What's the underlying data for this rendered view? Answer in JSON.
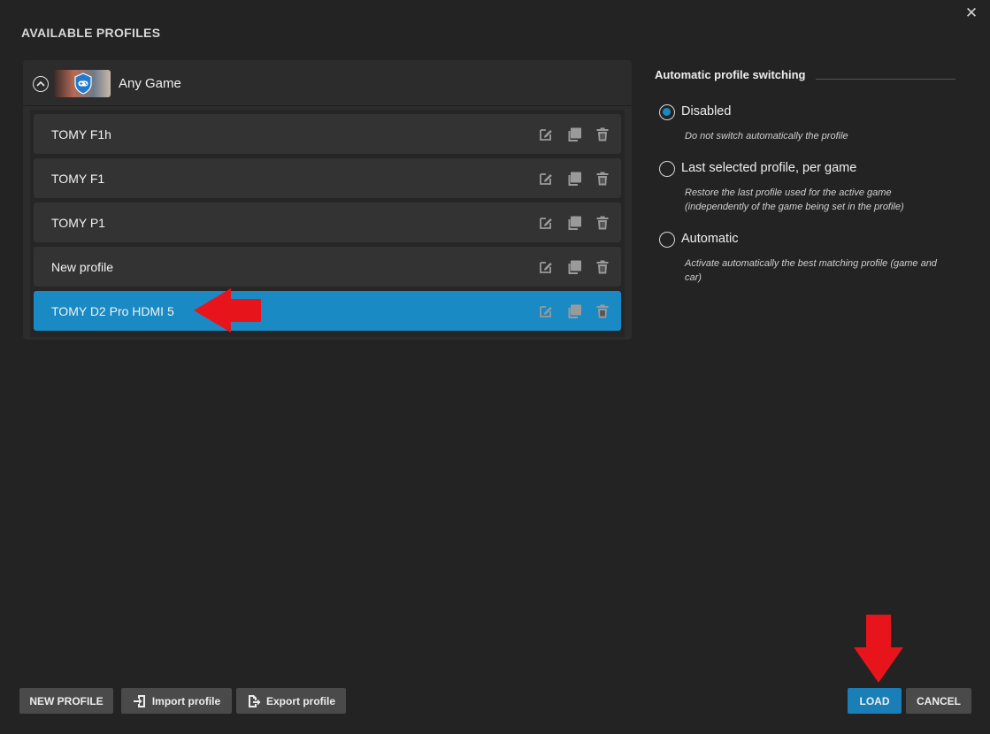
{
  "window": {
    "close_label": "✕"
  },
  "page_title": "AVAILABLE PROFILES",
  "game": {
    "name": "Any Game"
  },
  "profiles": [
    {
      "name": "TOMY F1h",
      "selected": false
    },
    {
      "name": "TOMY F1",
      "selected": false
    },
    {
      "name": "TOMY P1",
      "selected": false
    },
    {
      "name": "New profile",
      "selected": false
    },
    {
      "name": "TOMY D2 Pro HDMI 5",
      "selected": true
    }
  ],
  "auto_switching": {
    "title": "Automatic profile switching",
    "options": [
      {
        "label": "Disabled",
        "description": "Do not switch automatically the profile",
        "checked": true
      },
      {
        "label": "Last selected profile, per game",
        "description": "Restore the last profile used for the active game (independently of the game being set in the profile)",
        "checked": false
      },
      {
        "label": "Automatic",
        "description": "Activate automatically the best matching profile (game and car)",
        "checked": false
      }
    ]
  },
  "buttons": {
    "new_profile": "NEW PROFILE",
    "import_profile": "Import profile",
    "export_profile": "Export profile",
    "load": "LOAD",
    "cancel": "CANCEL"
  },
  "colors": {
    "accent": "#1a8ac4",
    "background": "#232323",
    "annotation": "#e8141c"
  }
}
